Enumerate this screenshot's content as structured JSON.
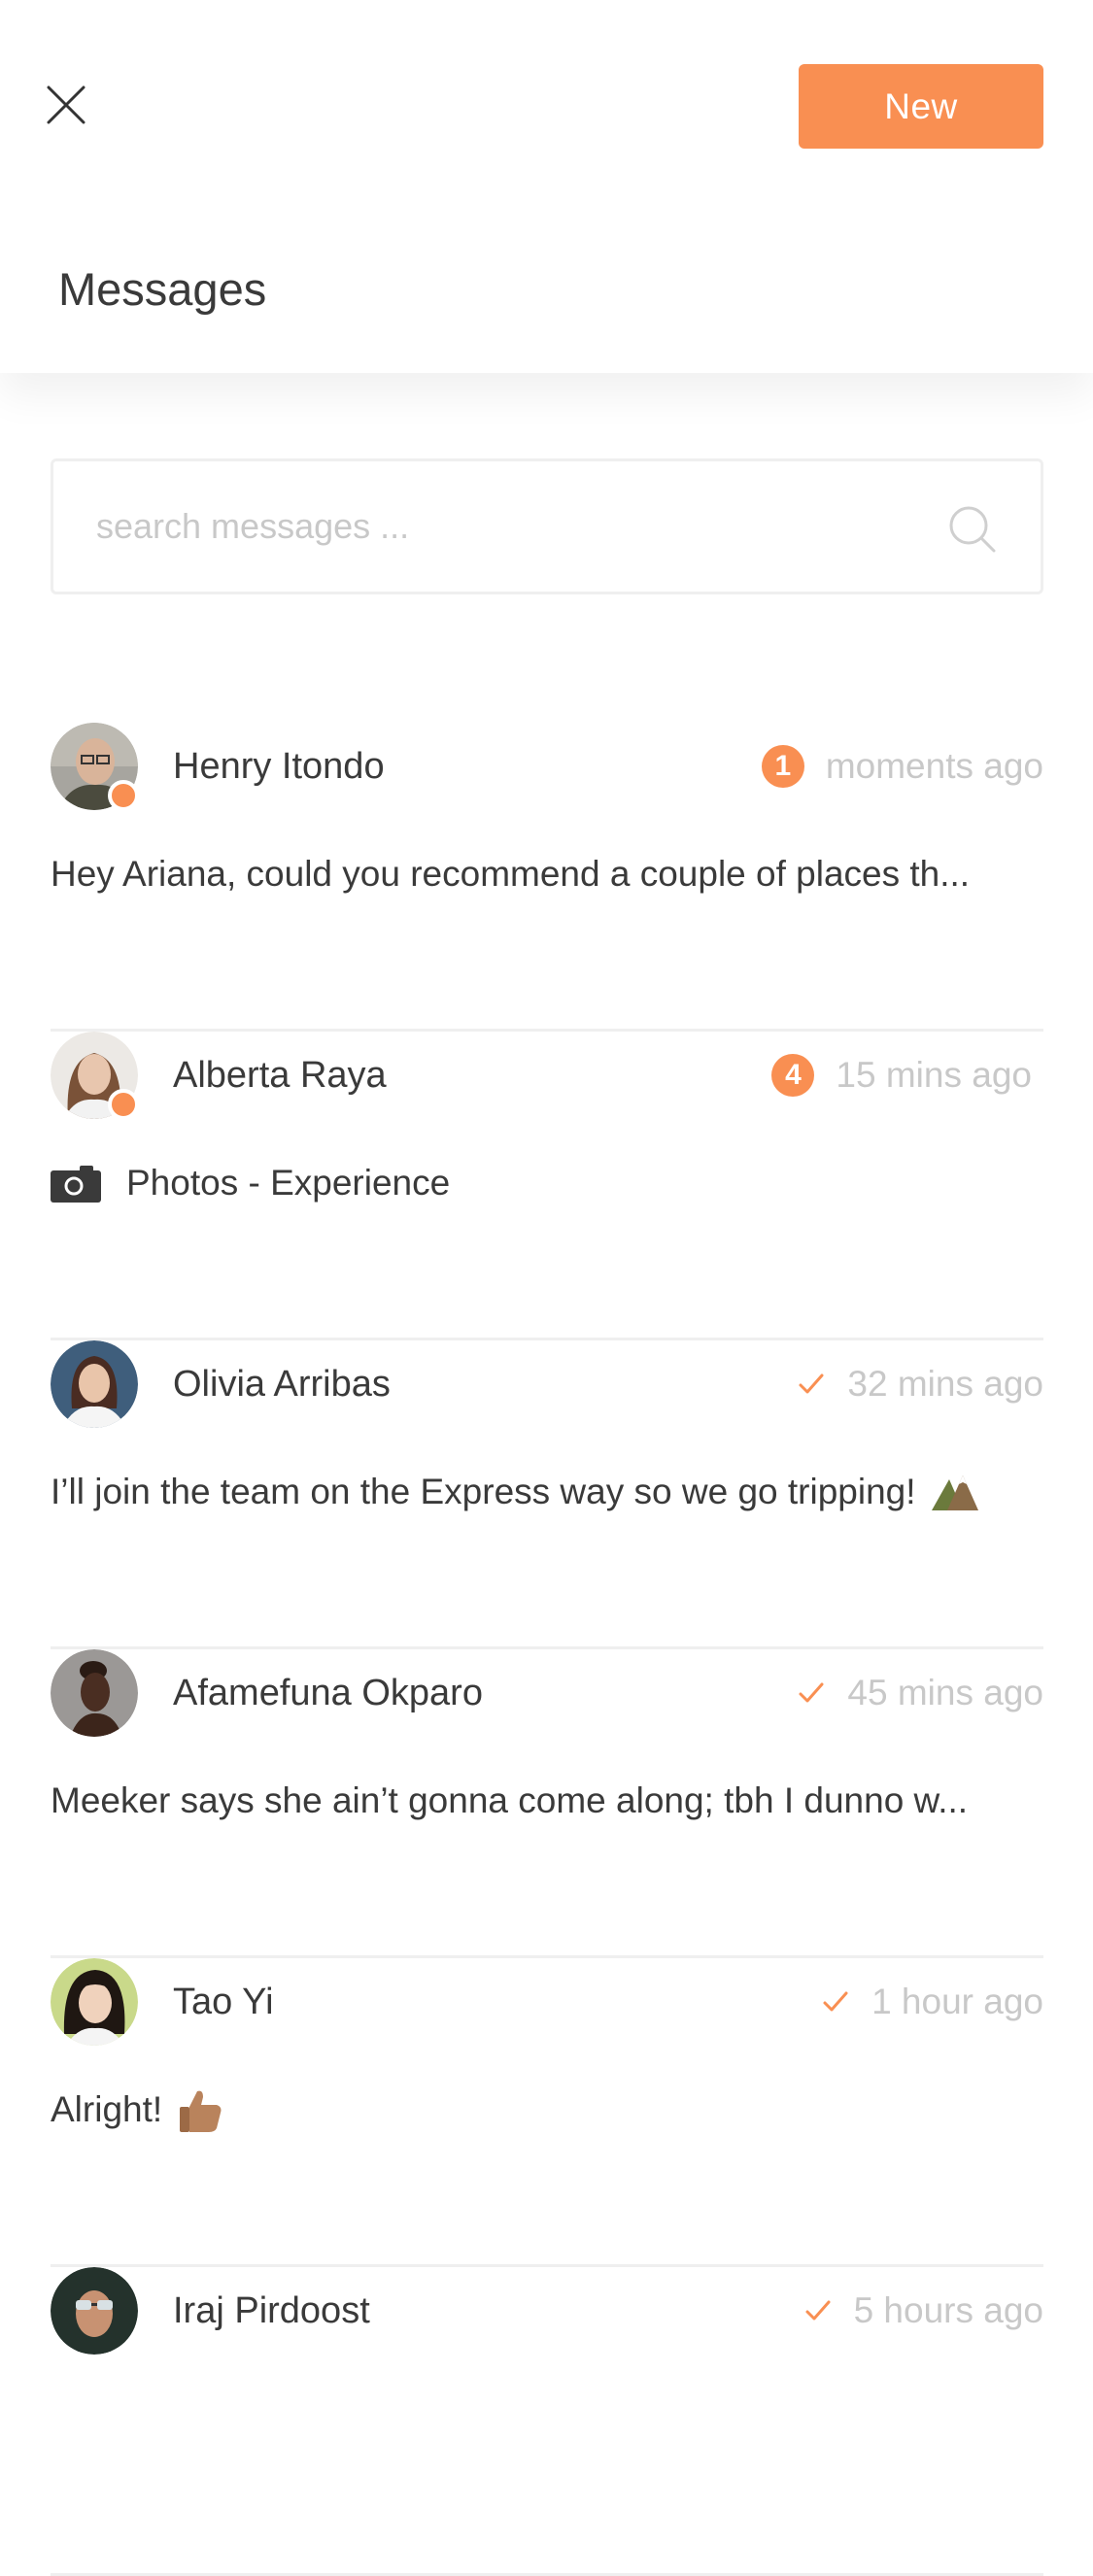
{
  "header": {
    "title": "Messages",
    "new_label": "New",
    "close_icon": "close-icon"
  },
  "search": {
    "placeholder": "search messages ...",
    "icon": "search-icon"
  },
  "colors": {
    "accent": "#f98f52",
    "text": "#3a3a3a",
    "muted": "#c8c8c8",
    "divider": "#efefef"
  },
  "conversations": [
    {
      "name": "Henry Itondo",
      "online": true,
      "status": "unread",
      "unread_count": "1",
      "time": "moments ago",
      "preview": "Hey Ariana, could you recommend a couple of places th..."
    },
    {
      "name": "Alberta Raya",
      "online": true,
      "status": "unread",
      "unread_count": "4",
      "time": "15 mins ago",
      "preview_icon": "camera-icon",
      "preview": "Photos - Experience"
    },
    {
      "name": "Olivia Arribas",
      "online": false,
      "status": "read",
      "status_icon": "check-icon",
      "time": "32 mins ago",
      "preview": "I’ll join the team on the Express way so we go tripping!",
      "preview_emoji": "mountain-emoji"
    },
    {
      "name": "Afamefuna Okparo",
      "online": false,
      "status": "read",
      "status_icon": "check-icon",
      "time": "45 mins ago",
      "preview": "Meeker says she ain’t gonna come along; tbh I dunno w..."
    },
    {
      "name": "Tao Yi",
      "online": false,
      "status": "read",
      "status_icon": "check-icon",
      "time": "1 hour ago",
      "preview": "Alright!",
      "preview_emoji": "thumbs-up-emoji"
    },
    {
      "name": "Iraj Pirdoost",
      "online": false,
      "status": "read",
      "status_icon": "check-icon",
      "time": "5 hours ago",
      "preview": ""
    }
  ]
}
